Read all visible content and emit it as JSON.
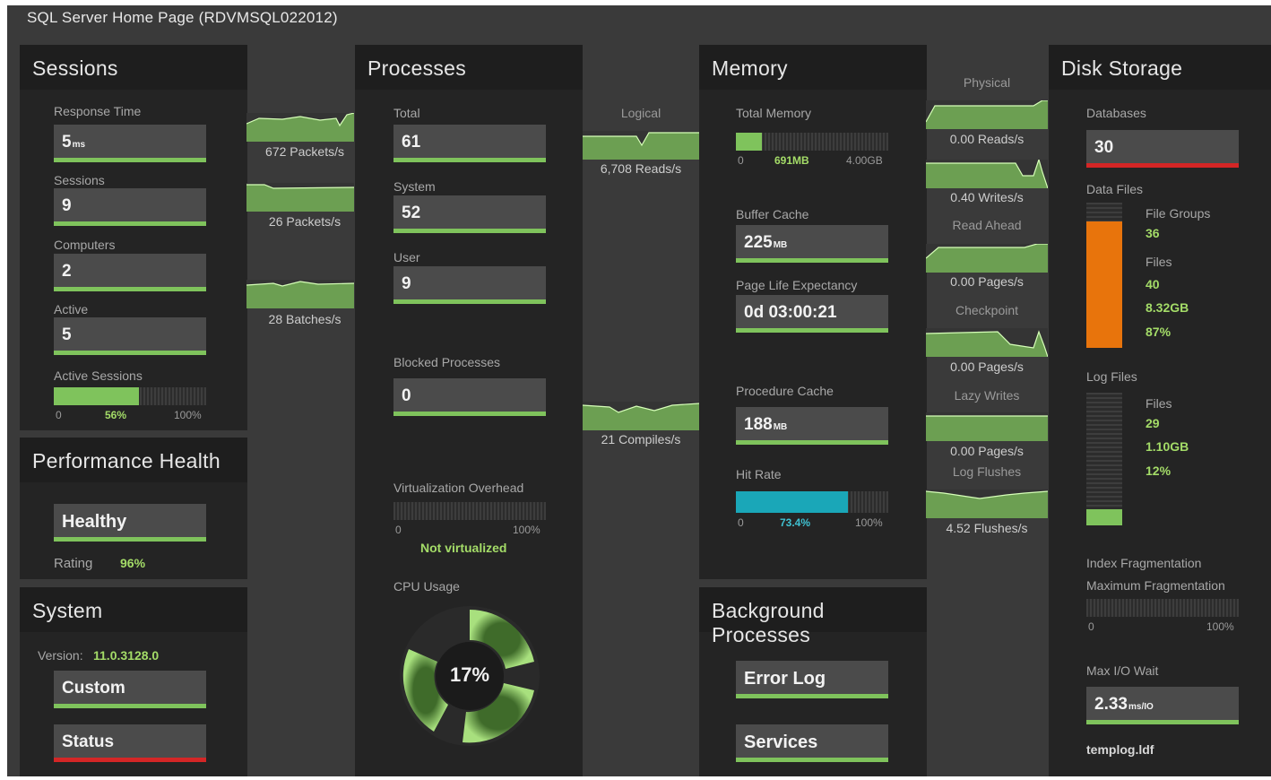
{
  "window_title": "SQL Server Home Page (RDVMSQL022012)",
  "sessions": {
    "title": "Sessions",
    "response_time_label": "Response Time",
    "response_time_value": "5",
    "response_time_unit": "ms",
    "sessions_label": "Sessions",
    "sessions_value": "9",
    "computers_label": "Computers",
    "computers_value": "2",
    "active_label": "Active",
    "active_value": "5",
    "active_sessions_label": "Active Sessions",
    "active_sessions_min": "0",
    "active_sessions_pct": "56%",
    "active_sessions_fraction": 0.56,
    "active_sessions_max": "100%"
  },
  "health": {
    "title": "Performance Health",
    "status": "Healthy",
    "rating_label": "Rating",
    "rating_value": "96%"
  },
  "system": {
    "title": "System",
    "version_label": "Version:",
    "version_value": "11.0.3128.0",
    "custom_button": "Custom",
    "status_button": "Status"
  },
  "network": {
    "packets_in": "672 Packets/s",
    "packets_out": "26 Packets/s",
    "batches": "28 Batches/s"
  },
  "processes": {
    "title": "Processes",
    "total_label": "Total",
    "total_value": "61",
    "system_label": "System",
    "system_value": "52",
    "user_label": "User",
    "user_value": "9",
    "blocked_label": "Blocked Processes",
    "blocked_value": "0",
    "virt_label": "Virtualization Overhead",
    "virt_min": "0",
    "virt_max": "100%",
    "virt_status": "Not virtualized",
    "cpu_label": "CPU Usage",
    "cpu_value": "17%"
  },
  "io_mid": {
    "logical_label": "Logical",
    "logical_reads": "6,708 Reads/s",
    "compiles": "21 Compiles/s"
  },
  "memory": {
    "title": "Memory",
    "total_label": "Total  Memory",
    "total_min": "0",
    "total_used": "691MB",
    "total_max": "4.00GB",
    "total_fraction": 0.17,
    "buffer_label": "Buffer Cache",
    "buffer_value": "225",
    "buffer_unit": "MB",
    "ple_label": "Page Life Expectancy",
    "ple_value": "0d 03:00:21",
    "proc_cache_label": "Procedure Cache",
    "proc_cache_value": "188",
    "proc_cache_unit": "MB",
    "hit_rate_label": "Hit Rate",
    "hit_min": "0",
    "hit_value": "73.4%",
    "hit_fraction": 0.734,
    "hit_max": "100%"
  },
  "physical": {
    "physical_label": "Physical",
    "reads": "0.00 Reads/s",
    "writes": "0.40 Writes/s",
    "read_ahead_label": "Read Ahead",
    "read_ahead": "0.00 Pages/s",
    "checkpoint_label": "Checkpoint",
    "checkpoint": "0.00 Pages/s",
    "lazy_label": "Lazy Writes",
    "lazy": "0.00 Pages/s",
    "log_flushes_label": "Log Flushes",
    "log_flushes": "4.52 Flushes/s"
  },
  "background": {
    "title": "Background Processes",
    "error_log": "Error Log",
    "services": "Services"
  },
  "disk": {
    "title": "Disk Storage",
    "databases_label": "Databases",
    "databases_value": "30",
    "data_files_label": "Data Files",
    "data_fill_fraction": 0.87,
    "file_groups_label": "File Groups",
    "file_groups_value": "36",
    "data_files_count_label": "Files",
    "data_files_count": "40",
    "data_size": "8.32GB",
    "data_pct": "87%",
    "log_files_label": "Log Files",
    "log_fill_fraction": 0.12,
    "log_files_count_label": "Files",
    "log_files_count": "29",
    "log_size": "1.10GB",
    "log_pct": "12%",
    "index_frag_label": "Index Fragmentation",
    "max_frag_label": "Maximum Fragmentation",
    "frag_min": "0",
    "frag_max": "100%",
    "max_io_label": "Max I/O Wait",
    "max_io_value": "2.33",
    "max_io_unit": "ms/IO",
    "max_io_file": "templog.ldf"
  },
  "colors": {
    "accent_green": "#7fc35c",
    "alert_red": "#d42626",
    "storage_orange": "#e8740c",
    "hit_cyan": "#1aa7b8"
  }
}
